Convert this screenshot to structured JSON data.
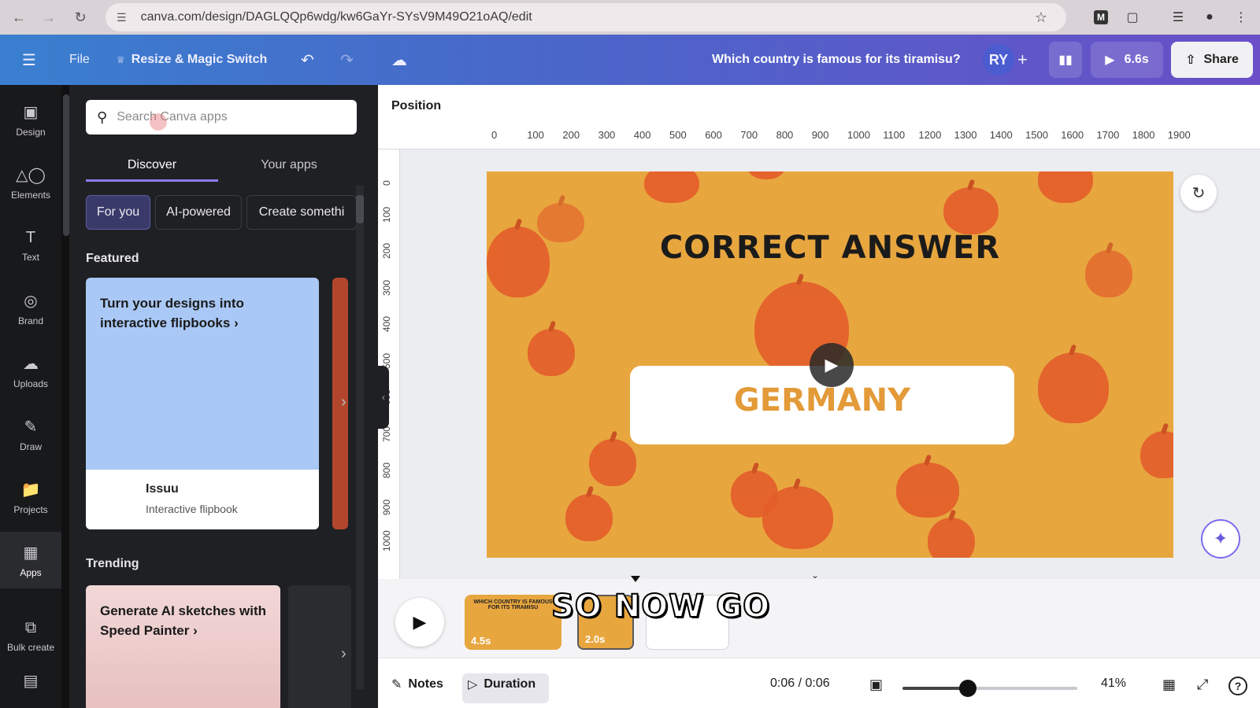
{
  "browser": {
    "url": "canva.com/design/DAGLQQp6wdg/kw6GaYr-SYsV9M49O21oAQ/edit"
  },
  "header": {
    "file": "File",
    "resize": "Resize & Magic Switch",
    "design_title": "Which country is famous for its tiramisu?",
    "avatar_initials": "RY",
    "play_duration": "6.6s",
    "share": "Share"
  },
  "rail": {
    "items": [
      {
        "label": "Design",
        "icon": "design-icon"
      },
      {
        "label": "Elements",
        "icon": "elements-icon"
      },
      {
        "label": "Text",
        "icon": "text-icon"
      },
      {
        "label": "Brand",
        "icon": "brand-icon"
      },
      {
        "label": "Uploads",
        "icon": "uploads-icon"
      },
      {
        "label": "Draw",
        "icon": "draw-icon"
      },
      {
        "label": "Projects",
        "icon": "projects-icon"
      },
      {
        "label": "Apps",
        "icon": "apps-icon"
      },
      {
        "label": "Bulk create",
        "icon": "bulk-create-icon"
      }
    ]
  },
  "panel": {
    "search_placeholder": "Search Canva apps",
    "tabs": [
      "Discover",
      "Your apps"
    ],
    "chips": [
      "For you",
      "AI-powered",
      "Create somethi"
    ],
    "featured_title": "Featured",
    "featured_card": {
      "title": "Turn your designs into interactive flipbooks",
      "app_name": "Issuu",
      "app_desc": "Interactive flipbook"
    },
    "trending_title": "Trending",
    "trending_card": {
      "title": "Generate AI sketches with Speed Painter"
    }
  },
  "editor": {
    "position_label": "Position",
    "ruler_top": [
      "0",
      "100",
      "200",
      "300",
      "400",
      "500",
      "600",
      "700",
      "800",
      "900",
      "1000",
      "1100",
      "1200",
      "1300",
      "1400",
      "1500",
      "1600",
      "1700",
      "1800",
      "1900"
    ],
    "ruler_left": [
      "0",
      "100",
      "200",
      "300",
      "400",
      "500",
      "600",
      "700",
      "800",
      "900",
      "1000"
    ],
    "slide": {
      "title": "CORRECT ANSWER",
      "answer": "GERMANY",
      "background": "#e8a63f",
      "accent": "#e35d2a"
    }
  },
  "timeline": {
    "thumb1_title": "WHICH COUNTRY IS FAMOUS FOR ITS TIRAMISU",
    "thumb1_duration": "4.5s",
    "thumb2_duration": "2.0s",
    "caption": "SO NOW GO"
  },
  "bottom": {
    "notes": "Notes",
    "duration": "Duration",
    "time": "0:06 / 0:06",
    "zoom": "41%",
    "zoom_level": 0.41
  }
}
